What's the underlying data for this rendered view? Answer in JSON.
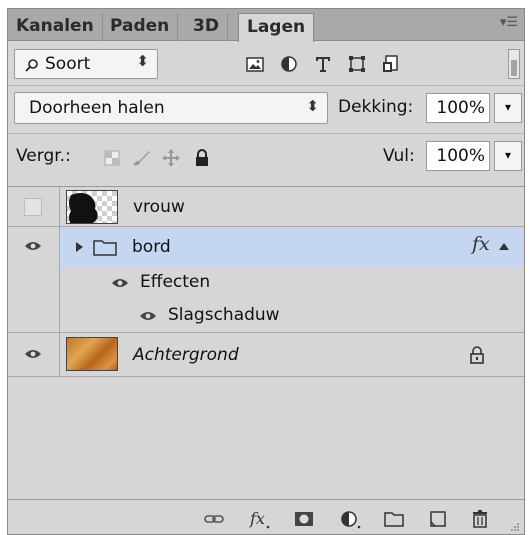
{
  "tabs": [
    {
      "label": "Kanalen"
    },
    {
      "label": "Paden"
    },
    {
      "label": "3D"
    },
    {
      "label": "Lagen"
    }
  ],
  "filter": {
    "kind_label": "Soort"
  },
  "blend": {
    "mode": "Doorheen halen"
  },
  "opacity": {
    "label": "Dekking:",
    "value": "100%"
  },
  "lock": {
    "label": "Vergr.:"
  },
  "fill": {
    "label": "Vul:",
    "value": "100%"
  },
  "layers": [
    {
      "name": "vrouw",
      "visible": false
    },
    {
      "name": "bord",
      "visible": true,
      "selected": true,
      "fx": "fx"
    },
    {
      "name": "Effecten"
    },
    {
      "name": "Slagschaduw"
    },
    {
      "name": "Achtergrond",
      "visible": true,
      "locked": true
    }
  ],
  "colors": {
    "selection": "#c5d6f0",
    "panel": "#d6d6d6",
    "tabbar": "#a9a9a9"
  }
}
